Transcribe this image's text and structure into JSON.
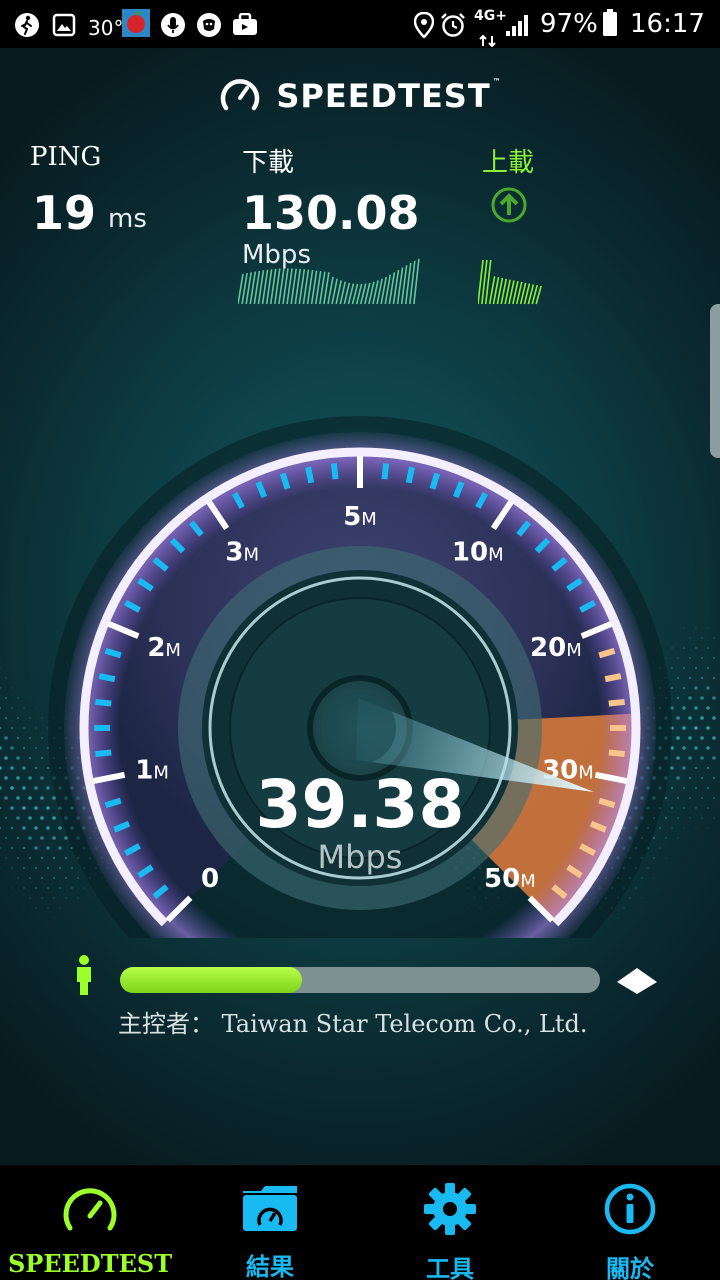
{
  "status_bar": {
    "icons": [
      "running-icon",
      "gallery-icon",
      "temperature-icon",
      "app-notification-icon",
      "microphone-icon",
      "shield-icon",
      "briefcase-icon",
      "location-icon",
      "alarm-icon",
      "network-4g-icon",
      "signal-icon",
      "battery-icon"
    ],
    "temperature": "30°",
    "network_type": "4G+",
    "battery": "97%",
    "time": "16:17"
  },
  "header": {
    "logo_text": "SPEEDTEST",
    "logo_tm": "™"
  },
  "stats": {
    "ping": {
      "label": "PING",
      "value": "19",
      "unit": "ms"
    },
    "download": {
      "label": "下載",
      "value": "130.08",
      "unit": "Mbps"
    },
    "upload": {
      "label": "上載"
    }
  },
  "gauge": {
    "ticks": [
      {
        "n": "0",
        "m": ""
      },
      {
        "n": "1",
        "m": "M"
      },
      {
        "n": "2",
        "m": "M"
      },
      {
        "n": "3",
        "m": "M"
      },
      {
        "n": "5",
        "m": "M"
      },
      {
        "n": "10",
        "m": "M"
      },
      {
        "n": "20",
        "m": "M"
      },
      {
        "n": "30",
        "m": "M"
      },
      {
        "n": "50",
        "m": "M"
      }
    ],
    "speed": "39.38",
    "unit": "Mbps"
  },
  "progress": {
    "fraction": 0.38
  },
  "host": {
    "label": "主控者：  Taiwan Star Telecom Co., Ltd."
  },
  "nav": {
    "items": [
      {
        "label": "SPEEDTEST",
        "icon": "speedometer-icon",
        "active": true
      },
      {
        "label": "結果",
        "icon": "folder-results-icon",
        "active": false
      },
      {
        "label": "工具",
        "icon": "gear-icon",
        "active": false
      },
      {
        "label": "關於",
        "icon": "info-icon",
        "active": false
      }
    ]
  },
  "colors": {
    "accent_green": "#9dff2a",
    "accent_blue": "#19b9f2",
    "upload_green": "#8bf03a"
  }
}
